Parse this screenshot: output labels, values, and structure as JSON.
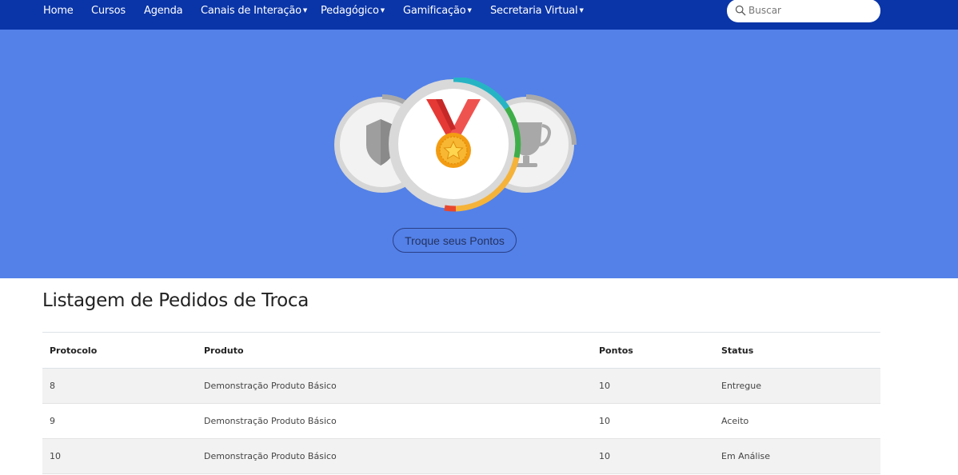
{
  "nav": {
    "items": [
      {
        "label": "Home",
        "dropdown": false
      },
      {
        "label": "Cursos",
        "dropdown": false
      },
      {
        "label": "Agenda",
        "dropdown": false
      },
      {
        "label": "Canais de Interação",
        "dropdown": true
      },
      {
        "label": "Pedagógico",
        "dropdown": true
      },
      {
        "label": "Gamificação",
        "dropdown": true
      },
      {
        "label": "Secretaria Virtual",
        "dropdown": true
      }
    ],
    "search_placeholder": "Buscar"
  },
  "hero": {
    "badges": [
      "shield-icon",
      "medal-icon",
      "trophy-icon"
    ],
    "button_label": "Troque seus Pontos"
  },
  "main": {
    "title": "Listagem de Pedidos de Troca",
    "columns": [
      "Protocolo",
      "Produto",
      "Pontos",
      "Status"
    ],
    "rows": [
      [
        "8",
        "Demonstração Produto Básico",
        "10",
        "Entregue"
      ],
      [
        "9",
        "Demonstração Produto Básico",
        "10",
        "Aceito"
      ],
      [
        "10",
        "Demonstração Produto Básico",
        "10",
        "Em Análise"
      ]
    ]
  },
  "colors": {
    "navbar": "#0a35a8",
    "hero": "#5381e8",
    "medal_gold": "#f5a623",
    "ribbon_red": "#e53935"
  }
}
